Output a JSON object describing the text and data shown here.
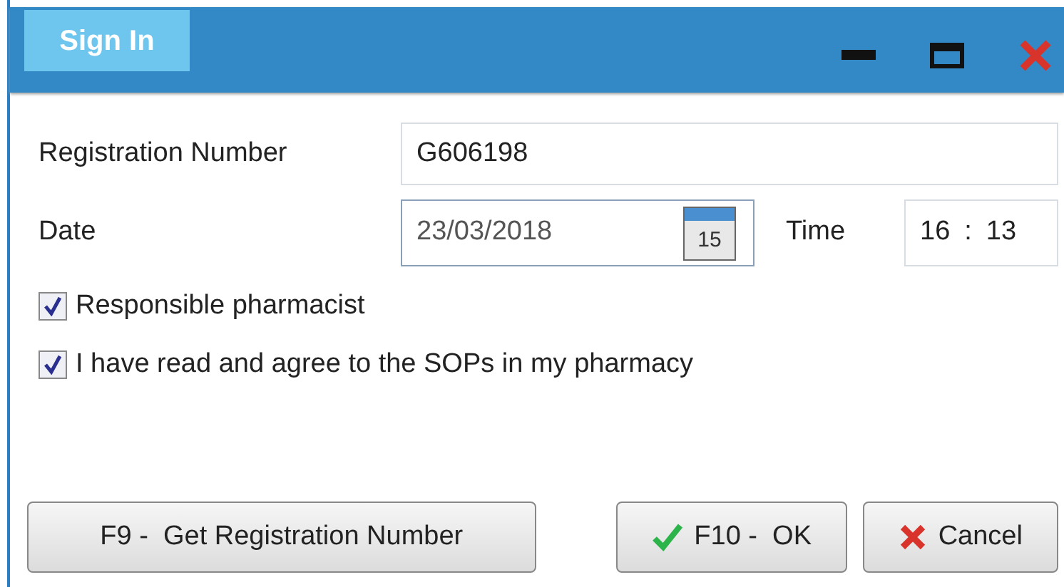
{
  "window": {
    "title": "Sign In",
    "controls": [
      {
        "kind": "minimize"
      },
      {
        "kind": "maximize"
      },
      {
        "kind": "close"
      }
    ]
  },
  "fields": {
    "registration_number": {
      "label": "Registration Number",
      "value": "G606198"
    },
    "date": {
      "label": "Date",
      "value": "23/03/2018",
      "calendar_day": "15"
    },
    "time": {
      "label": "Time",
      "hours": "16",
      "separator": ":",
      "minutes": "13"
    }
  },
  "checkboxes": [
    {
      "label": "Responsible pharmacist",
      "checked": true
    },
    {
      "label": "I have read and agree to the SOPs in my pharmacy",
      "checked": true
    }
  ],
  "buttons": [
    {
      "kind": "plain",
      "label": "F9 -  Get Registration Number"
    },
    {
      "kind": "ok",
      "label": "F10 -  OK"
    },
    {
      "kind": "cancel",
      "label": "Cancel"
    }
  ]
}
